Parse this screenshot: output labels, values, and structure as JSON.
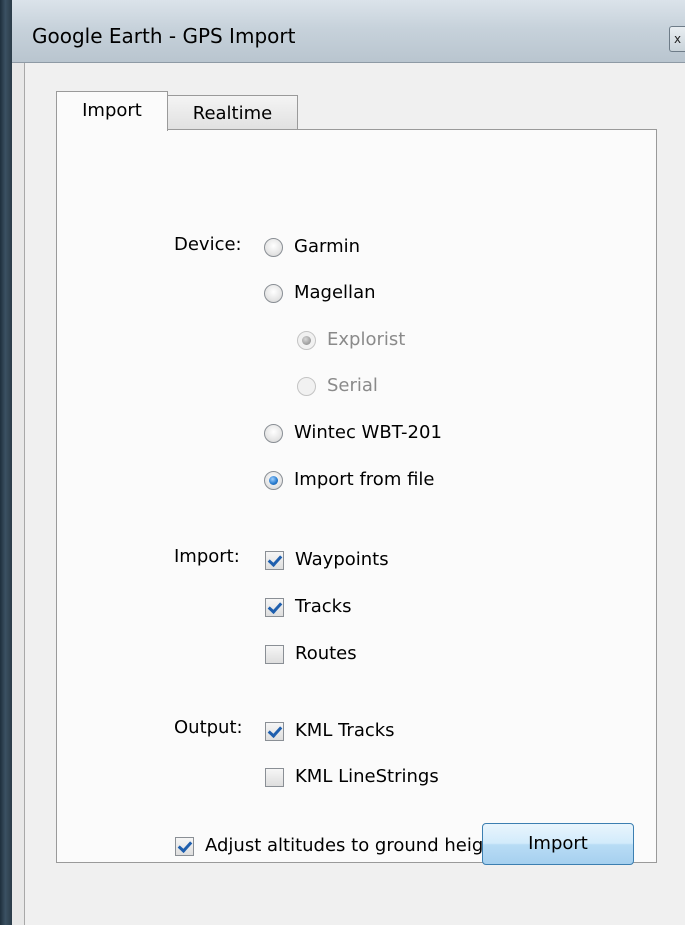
{
  "window": {
    "title": "Google Earth - GPS Import",
    "close_glyph": "x"
  },
  "tabs": [
    {
      "label": "Import",
      "selected": true
    },
    {
      "label": "Realtime",
      "selected": false
    }
  ],
  "device": {
    "label": "Device:",
    "options": [
      {
        "label": "Garmin",
        "checked": false,
        "enabled": true
      },
      {
        "label": "Magellan",
        "checked": false,
        "enabled": true
      },
      {
        "label": "Explorist",
        "checked": true,
        "enabled": false
      },
      {
        "label": "Serial",
        "checked": false,
        "enabled": false
      },
      {
        "label": "Wintec WBT-201",
        "checked": false,
        "enabled": true
      },
      {
        "label": "Import from file",
        "checked": true,
        "enabled": true
      }
    ]
  },
  "import": {
    "label": "Import:",
    "options": [
      {
        "label": "Waypoints",
        "checked": true
      },
      {
        "label": "Tracks",
        "checked": true
      },
      {
        "label": "Routes",
        "checked": false
      }
    ]
  },
  "output": {
    "label": "Output:",
    "options": [
      {
        "label": "KML Tracks",
        "checked": true
      },
      {
        "label": "KML LineStrings",
        "checked": false
      }
    ]
  },
  "adjust_altitudes": {
    "label": "Adjust altitudes to ground height",
    "checked": true
  },
  "import_button": {
    "label": "Import"
  },
  "colors": {
    "accent": "#2b7ed0",
    "button_border": "#3c7fb1",
    "disabled_text": "#8a8a8a"
  }
}
